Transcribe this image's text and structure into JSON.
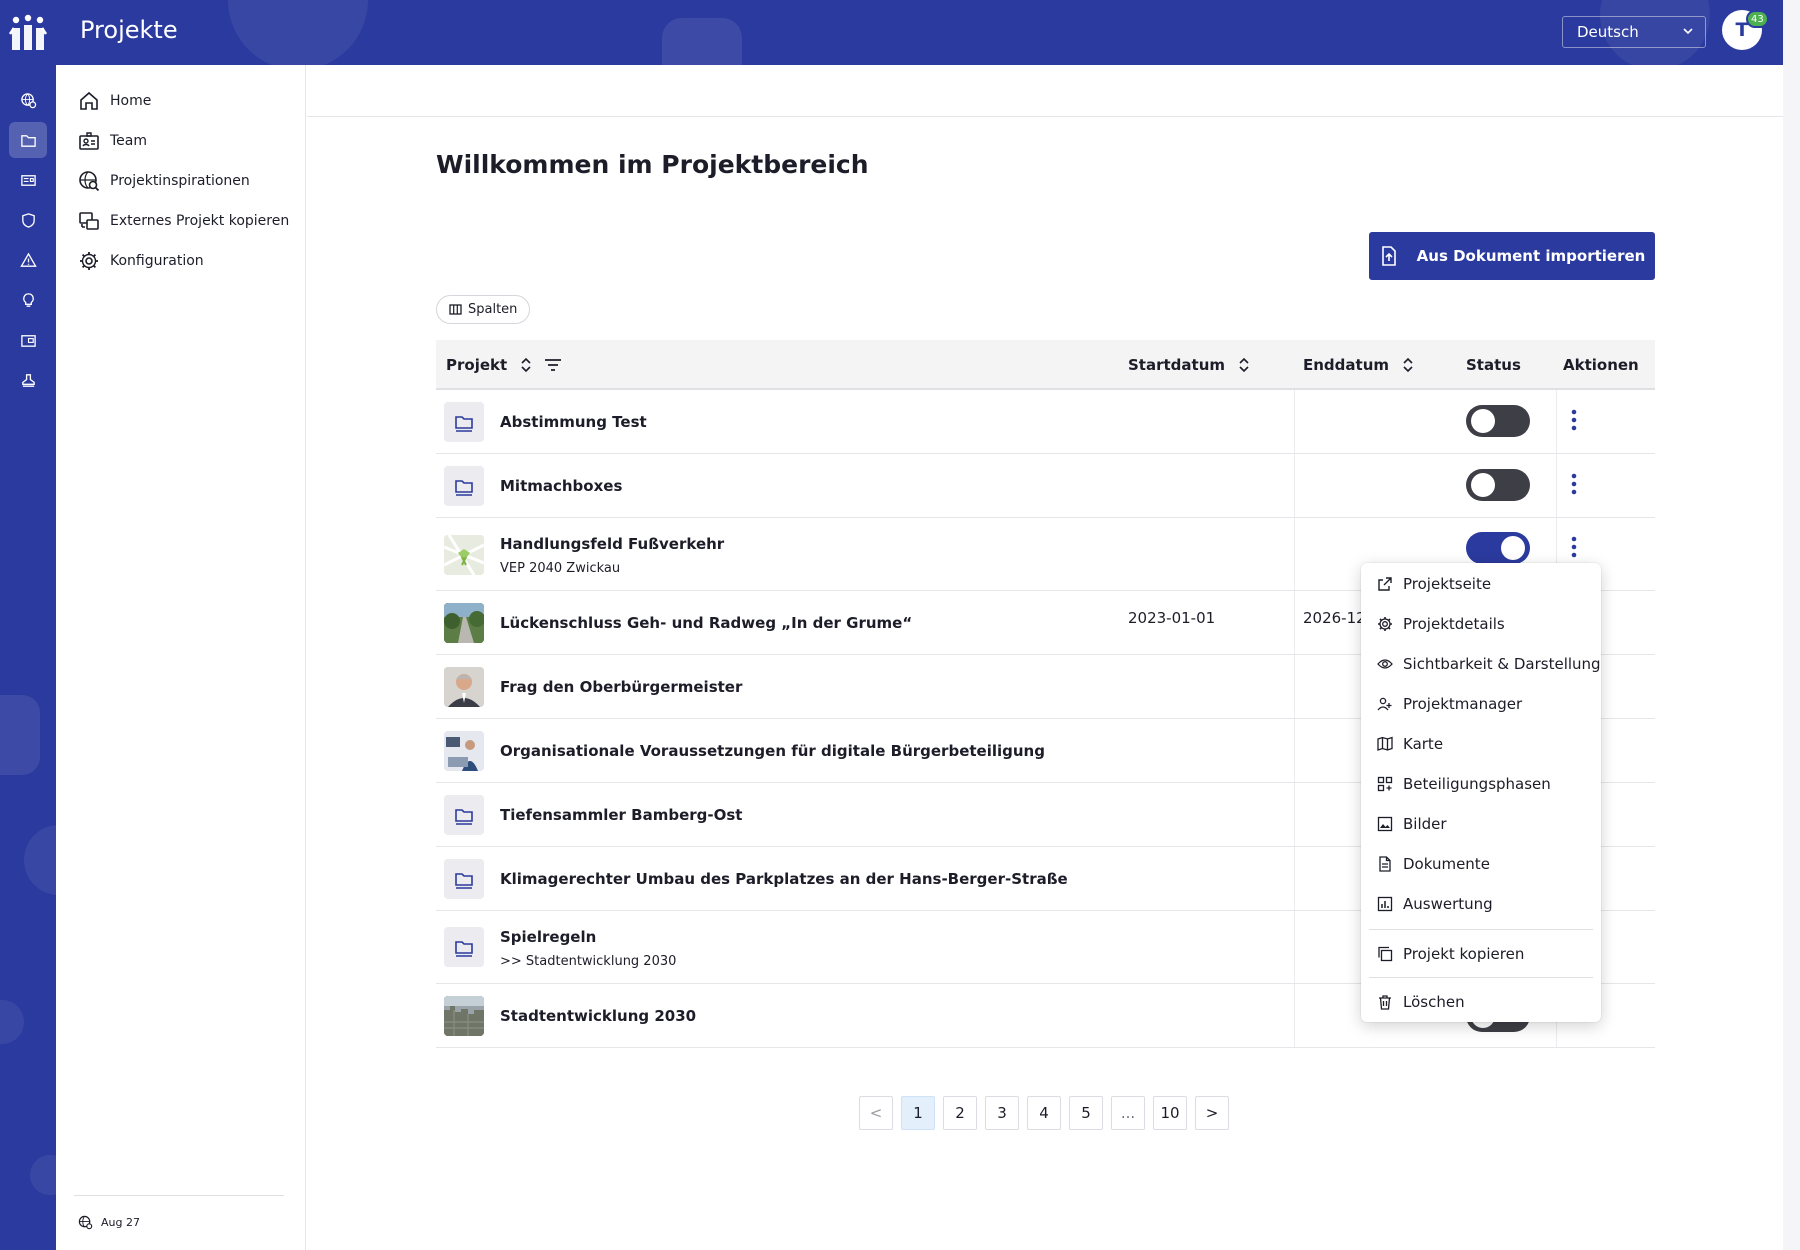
{
  "header": {
    "title": "Projekte",
    "language": "Deutsch",
    "avatar_initial": "T",
    "notification_count": "43"
  },
  "rail": {
    "icons": [
      "globe-settings-icon",
      "folder-icon",
      "newspaper-icon",
      "shield-icon",
      "warning-icon",
      "lightbulb-icon",
      "wallet-icon",
      "stamp-icon"
    ],
    "active": "folder-icon"
  },
  "sidebar": {
    "items": [
      {
        "label": "Home",
        "icon": "home-icon"
      },
      {
        "label": "Team",
        "icon": "team-badge-icon"
      },
      {
        "label": "Projektinspirationen",
        "icon": "globe-search-icon"
      },
      {
        "label": "Externes Projekt kopieren",
        "icon": "copy-external-icon"
      },
      {
        "label": "Konfiguration",
        "icon": "gear-icon"
      }
    ],
    "footer": "Aug 27"
  },
  "main": {
    "title": "Willkommen im Projektbereich",
    "import_button": "Aus Dokument importieren",
    "columns_button": "Spalten"
  },
  "table": {
    "headers": {
      "project": "Projekt",
      "start": "Startdatum",
      "end": "Enddatum",
      "status": "Status",
      "actions": "Aktionen"
    },
    "rows": [
      {
        "name": "Abstimmung Test",
        "sub": "",
        "thumb": "folder",
        "start": "",
        "end": "",
        "status": false
      },
      {
        "name": "Mitmachboxes",
        "sub": "",
        "thumb": "folder",
        "start": "",
        "end": "",
        "status": false
      },
      {
        "name": "Handlungsfeld Fußverkehr",
        "sub": "VEP 2040 Zwickau",
        "thumb": "map-image",
        "start": "",
        "end": "",
        "status": true
      },
      {
        "name": "Lückenschluss Geh- und Radweg „In der Grume“",
        "sub": "",
        "thumb": "road-image",
        "start": "2023-01-01",
        "end": "2026-12-",
        "status": null
      },
      {
        "name": "Frag den Oberbürgermeister",
        "sub": "",
        "thumb": "portrait-image",
        "start": "",
        "end": "",
        "status": null
      },
      {
        "name": "Organisationale Voraussetzungen für digitale Bürgerbeteiligung",
        "sub": "",
        "thumb": "office-image",
        "start": "",
        "end": "",
        "status": null
      },
      {
        "name": "Tiefensammler Bamberg-Ost",
        "sub": "",
        "thumb": "folder",
        "start": "",
        "end": "",
        "status": null
      },
      {
        "name": "Klimagerechter Umbau des Parkplatzes an der Hans-Berger-Straße",
        "sub": "",
        "thumb": "folder",
        "start": "",
        "end": "",
        "status": null
      },
      {
        "name": "Spielregeln",
        "sub": ">> Stadtentwicklung 2030",
        "thumb": "folder",
        "start": "",
        "end": "",
        "status": null
      },
      {
        "name": "Stadtentwicklung 2030",
        "sub": "",
        "thumb": "city-image",
        "start": "",
        "end": "",
        "status": null
      }
    ]
  },
  "context_menu": {
    "items": [
      {
        "label": "Projektseite",
        "icon": "external-link-icon"
      },
      {
        "label": "Projektdetails",
        "icon": "gear-icon"
      },
      {
        "label": "Sichtbarkeit & Darstellung",
        "icon": "eye-icon"
      },
      {
        "label": "Projektmanager",
        "icon": "user-manage-icon"
      },
      {
        "label": "Karte",
        "icon": "map-icon"
      },
      {
        "label": "Beteiligungsphasen",
        "icon": "grid-plus-icon"
      },
      {
        "label": "Bilder",
        "icon": "image-icon"
      },
      {
        "label": "Dokumente",
        "icon": "document-icon"
      },
      {
        "label": "Auswertung",
        "icon": "bar-chart-icon"
      },
      {
        "label": "Projekt kopieren",
        "icon": "copy-icon"
      },
      {
        "label": "Löschen",
        "icon": "trash-icon"
      }
    ]
  },
  "pagination": {
    "prev": "<",
    "pages": [
      "1",
      "2",
      "3",
      "4",
      "5",
      "...",
      "10"
    ],
    "current": "1",
    "next": ">"
  },
  "colors": {
    "brand": "#2b3a9e",
    "header_bg": "#f4f4f5",
    "toggle_off": "#3e3e46",
    "active_page": "#e3f0fc"
  }
}
